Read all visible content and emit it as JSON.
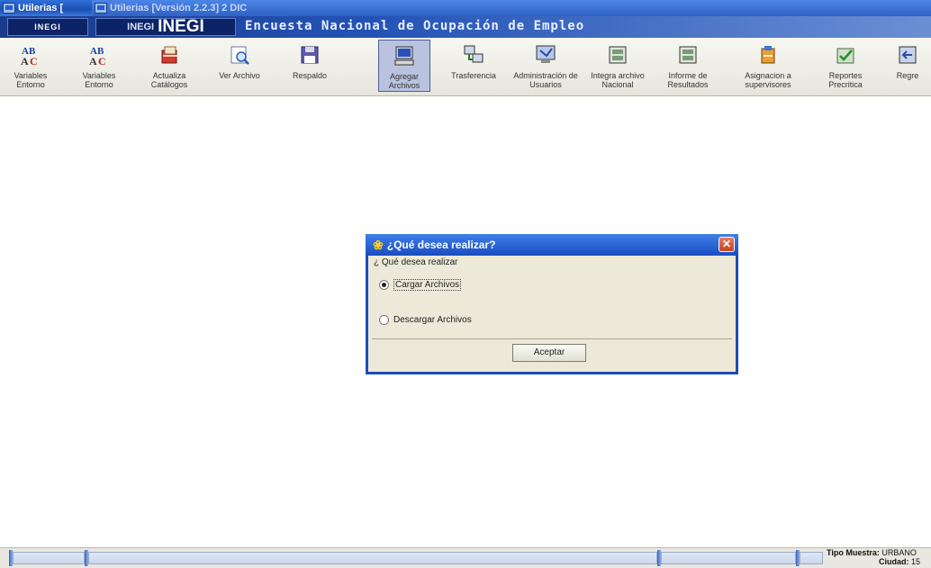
{
  "window": {
    "title_front": "Utilerias [",
    "title_back": "Utilerias [Versión 2.2.3] 2 DIC"
  },
  "banner": {
    "logo_small": "INEGI",
    "logo_prefix": "INEGI",
    "logo_main": "INEGI",
    "title": "Encuesta Nacional de Ocupación de Empleo"
  },
  "toolbar": {
    "items": [
      {
        "label": "Variables Entorno",
        "icon": "abc-icon"
      },
      {
        "label": "Variables Entorno",
        "icon": "abc-icon"
      },
      {
        "label": "Actualiza Catálogos",
        "icon": "catalog-update-icon"
      },
      {
        "label": "Ver Archivo",
        "icon": "magnifier-icon"
      },
      {
        "label": "Respaldo",
        "icon": "floppy-disk-icon"
      },
      {
        "label": "Agregar Archivos",
        "icon": "computer-icon"
      },
      {
        "label": "Trasferencia",
        "icon": "network-transfer-icon"
      },
      {
        "label": "Administración de Usuarios",
        "icon": "users-admin-icon"
      },
      {
        "label": "Integra archivo Nacional",
        "icon": "file-cabinet-icon"
      },
      {
        "label": "Informe de Resultados",
        "icon": "report-icon"
      },
      {
        "label": "Asignacion a supervisores",
        "icon": "supervisors-icon"
      },
      {
        "label": "Reportes Precritica",
        "icon": "check-report-icon"
      },
      {
        "label": "Regre",
        "icon": "back-icon"
      }
    ],
    "active_index": 5
  },
  "dialog": {
    "title": "¿Qué desea realizar?",
    "question": "¿ Qué desea realizar",
    "option_upload": "Cargar Archivos",
    "option_download": "Descargar Archivos",
    "selected": "Cargar Archivos",
    "accept_label": "Aceptar"
  },
  "status": {
    "sample_label": "Tipo Muestra:",
    "sample_value": "URBANO",
    "city_label": "Ciudad:",
    "city_value": "15"
  }
}
